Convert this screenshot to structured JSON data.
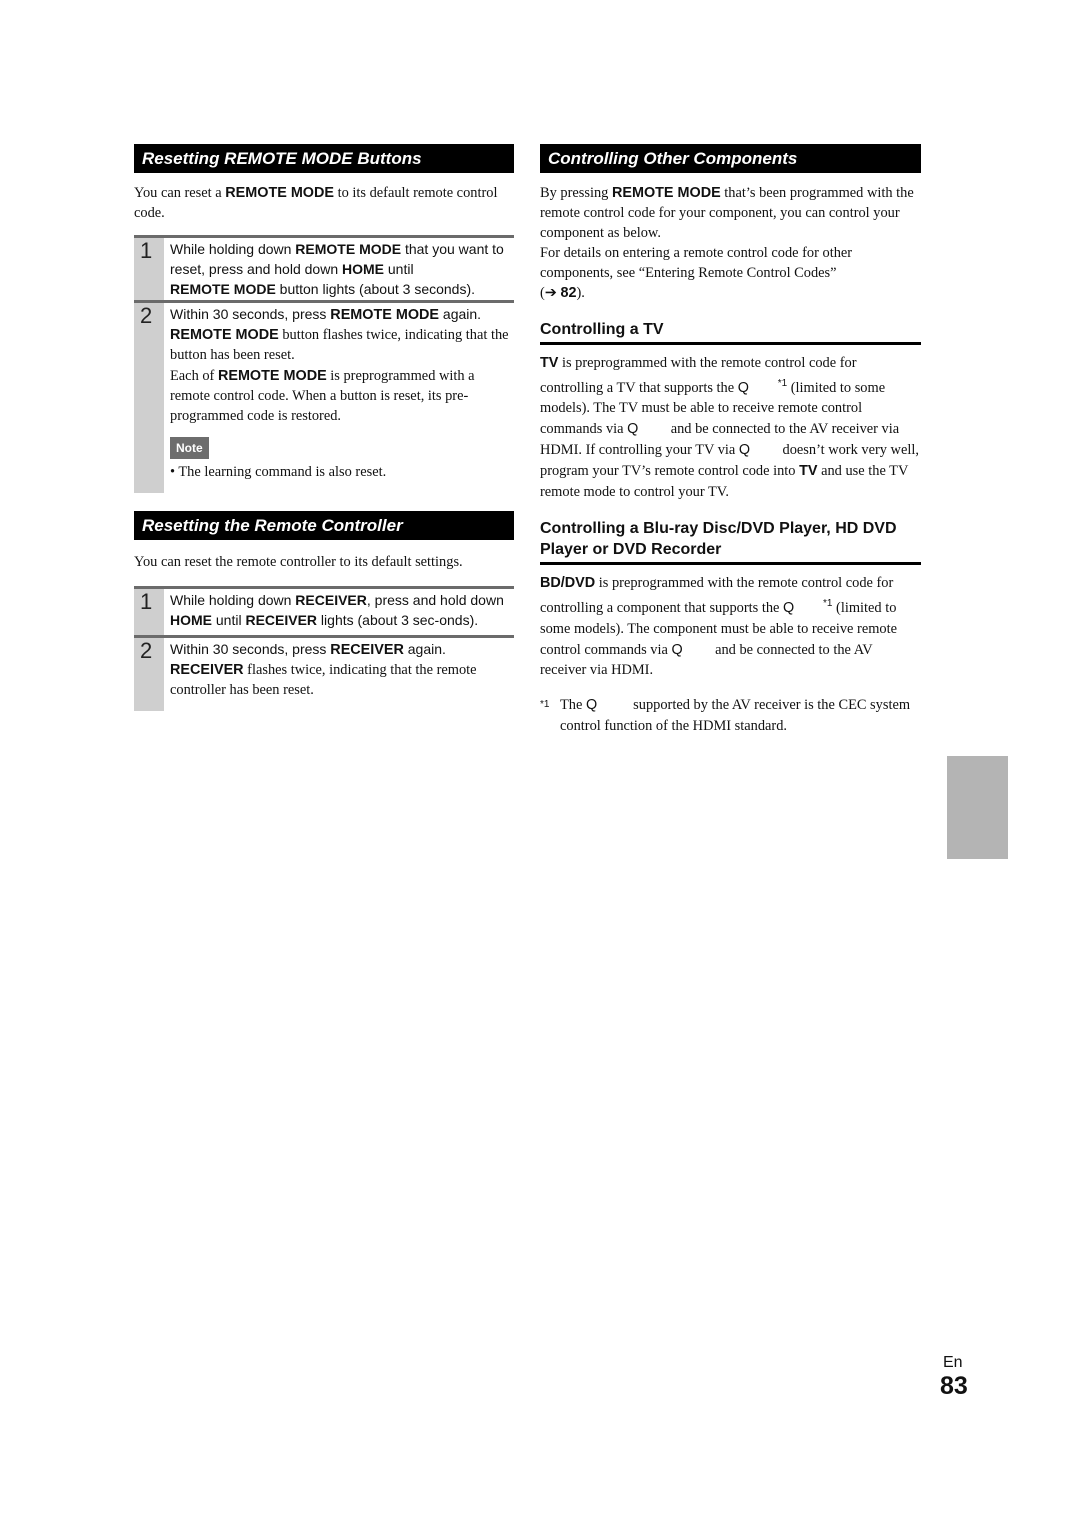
{
  "left": {
    "section1": {
      "title": "Resetting REMOTE MODE Buttons",
      "intro_pre": "You can reset a ",
      "intro_bold": "REMOTE MODE",
      "intro_post": " to its default remote control code.",
      "steps": [
        {
          "num": "1",
          "t1": "While holding down ",
          "b1": "REMOTE MODE",
          "t2": " that you want to reset, press and hold down ",
          "b2": "HOME",
          "t3": " until ",
          "b3": "REMOTE MODE",
          "t4": " button lights (about 3 seconds)."
        },
        {
          "num": "2",
          "t1": "Within 30 seconds, press ",
          "b1": "REMOTE MODE",
          "t2": " again.",
          "b2": "REMOTE MODE",
          "t3": " button flashes twice, indicating that the button has been reset.",
          "p2_pre": "Each of ",
          "p2_bold": "REMOTE MODE",
          "p2_post": " is preprogrammed with a remote control code. When a button is reset, its pre-programmed code is restored.",
          "note_label": "Note",
          "note_text": "• The learning command is also reset."
        }
      ]
    },
    "section2": {
      "title": "Resetting the Remote Controller",
      "intro": "You can reset the remote controller to its default settings.",
      "steps": [
        {
          "num": "1",
          "t1": "While holding down ",
          "b1": "RECEIVER",
          "t2": ", press and hold down ",
          "b2": "HOME",
          "t3": " until ",
          "b3": "RECEIVER",
          "t4": " lights (about 3 sec-onds)."
        },
        {
          "num": "2",
          "t1": "Within 30 seconds, press ",
          "b1": "RECEIVER",
          "t2": " again.",
          "b2": "RECEIVER",
          "t3": " flashes twice, indicating that the remote controller has been reset."
        }
      ]
    }
  },
  "right": {
    "section": {
      "title": "Controlling Other Components",
      "p1_pre": "By pressing ",
      "p1_bold": "REMOTE MODE",
      "p1_post": " that’s been programmed with the remote control code for your component, you can control your component as below.",
      "p2": "For details on entering a remote control code for other components, see “Entering Remote Control Codes”",
      "p2_ref_open": "(➔ ",
      "p2_ref_page": "82",
      "p2_ref_close": ")."
    },
    "tv": {
      "heading": "Controlling a TV",
      "b1": "TV",
      "t1": " is preprogrammed with the remote control code for controlling a TV that supports the ",
      "q1": "Q",
      "sup1": "*1",
      "t2": " (limited to some models). The TV must be able to receive remote control commands via ",
      "q2": "Q",
      "t3": " and be connected to the AV receiver via HDMI. If controlling your TV via ",
      "q3": "Q",
      "t4": " doesn’t work very well, program your TV’s remote control code into ",
      "b2": "TV",
      "t5": " and use the TV remote mode to control your TV."
    },
    "bd": {
      "heading": "Controlling a Blu-ray Disc/DVD Player, HD DVD Player or DVD Recorder",
      "b1": "BD/DVD",
      "t1": " is preprogrammed with the remote control code for controlling a component that supports the ",
      "q1": "Q",
      "sup1": "*1",
      "t2": " (limited to some models). The component must be able to receive remote control commands via ",
      "q2": "Q",
      "t3": " and be connected to the AV receiver via HDMI."
    },
    "footnote": {
      "mark": "*1",
      "t1": "The ",
      "q": "Q",
      "t2": " supported by the AV receiver is the CEC system control function of the HDMI standard."
    }
  },
  "footer": {
    "language": "En",
    "page_number": "83"
  },
  "colors": {
    "section_bar": "#000000",
    "step_bar": "#cfcfcf",
    "note_badge": "#6d6d6d",
    "side_tab": "#b4b4b4"
  }
}
